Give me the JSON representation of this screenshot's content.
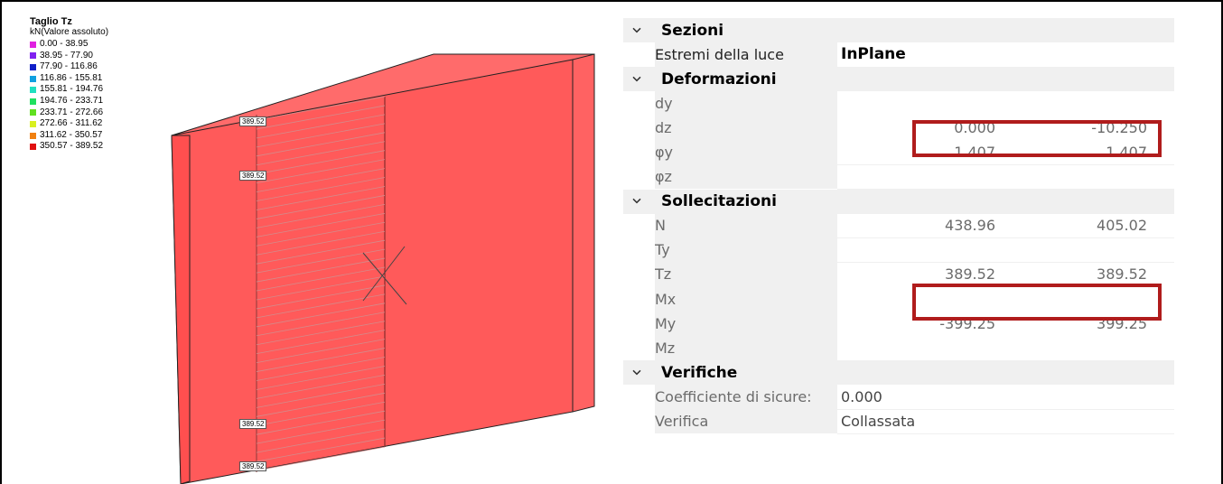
{
  "legend": {
    "title": "Taglio Tz",
    "unit": "kN(Valore assoluto)",
    "items": [
      {
        "label": "0.00 - 38.95",
        "color": "#e020e0"
      },
      {
        "label": "38.95 - 77.90",
        "color": "#8020f0"
      },
      {
        "label": "77.90 - 116.86",
        "color": "#1020c8"
      },
      {
        "label": "116.86 - 155.81",
        "color": "#10a0e0"
      },
      {
        "label": "155.81 - 194.76",
        "color": "#20e0c0"
      },
      {
        "label": "194.76 - 233.71",
        "color": "#20e060"
      },
      {
        "label": "233.71 - 272.66",
        "color": "#60e020"
      },
      {
        "label": "272.66 - 311.62",
        "color": "#d8f020"
      },
      {
        "label": "311.62 - 350.57",
        "color": "#f08010"
      },
      {
        "label": "350.57 - 389.52",
        "color": "#e01010"
      }
    ]
  },
  "model": {
    "labels": [
      "389.52",
      "389.52",
      "389.52",
      "389.52"
    ],
    "fill_color": "#ff5a5a"
  },
  "grid": {
    "sections": {
      "sezioni": "Sezioni",
      "deformazioni": "Deformazioni",
      "sollecitazioni": "Sollecitazioni",
      "verifiche": "Verifiche"
    },
    "estremi": {
      "label": "Estremi della luce",
      "value": "InPlane"
    },
    "dy": {
      "label": "dy",
      "v1": "",
      "v2": ""
    },
    "dz": {
      "label": "dz",
      "v1": "0.000",
      "v2": "-10.250"
    },
    "phiy": {
      "label": "φy",
      "v1": "1.407",
      "v2": "1.407"
    },
    "phiz": {
      "label": "φz",
      "v1": "",
      "v2": ""
    },
    "N": {
      "label": "N",
      "v1": "438.96",
      "v2": "405.02"
    },
    "Ty": {
      "label": "Ty",
      "v1": "",
      "v2": ""
    },
    "Tz": {
      "label": "Tz",
      "v1": "389.52",
      "v2": "389.52"
    },
    "Mx": {
      "label": "Mx",
      "v1": "",
      "v2": ""
    },
    "My": {
      "label": "My",
      "v1": "-399.25",
      "v2": "399.25"
    },
    "Mz": {
      "label": "Mz",
      "v1": "",
      "v2": ""
    },
    "coeff": {
      "label": "Coefficiente di sicure:",
      "value": "0.000"
    },
    "verifica": {
      "label": "Verifica",
      "value": "Collassata"
    }
  },
  "highlight_color": "#b01c1c"
}
